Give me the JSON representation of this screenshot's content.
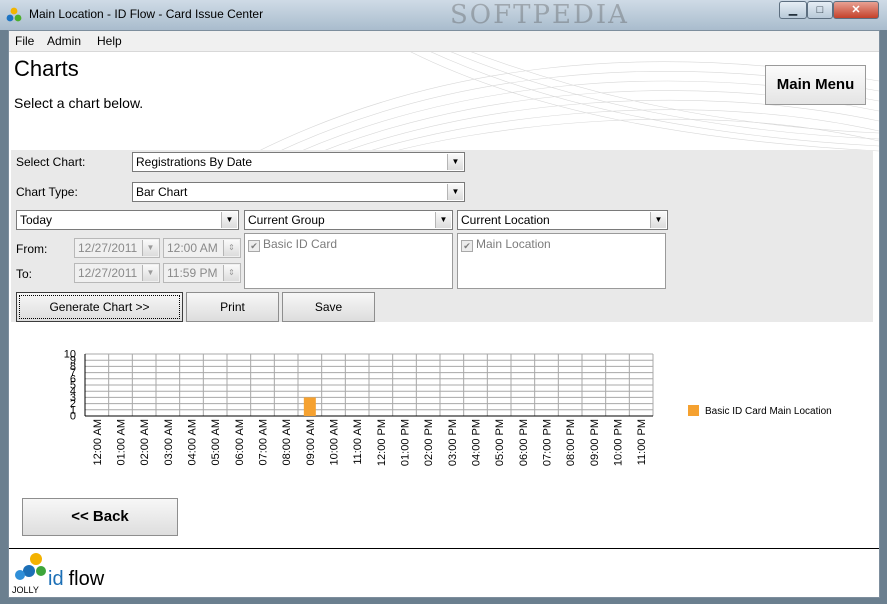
{
  "window": {
    "title": "Main Location - ID Flow - Card Issue Center",
    "watermark": "SOFTPEDIA",
    "minimize_glyph": "▁",
    "maximize_glyph": "□",
    "close_glyph": "✕"
  },
  "menu": [
    "File",
    "Admin",
    "Help"
  ],
  "header": {
    "title": "Charts",
    "subtitle": "Select a chart below.",
    "main_menu_label": "Main Menu"
  },
  "form": {
    "select_chart_label": "Select Chart:",
    "select_chart_value": "Registrations By Date",
    "chart_type_label": "Chart Type:",
    "chart_type_value": "Bar Chart",
    "period_value": "Today",
    "group_value": "Current Group",
    "location_value": "Current Location",
    "from_label": "From:",
    "to_label": "To:",
    "from_date": "12/27/2011",
    "from_time": "12:00 AM",
    "to_date": "12/27/2011",
    "to_time": "11:59 PM",
    "group_items": [
      "Basic ID Card"
    ],
    "location_items": [
      "Main Location"
    ]
  },
  "buttons": {
    "generate": "Generate Chart >>",
    "print": "Print",
    "save": "Save",
    "back": "<< Back"
  },
  "chart_data": {
    "type": "bar",
    "categories": [
      "12:00 AM",
      "01:00 AM",
      "02:00 AM",
      "03:00 AM",
      "04:00 AM",
      "05:00 AM",
      "06:00 AM",
      "07:00 AM",
      "08:00 AM",
      "09:00 AM",
      "10:00 AM",
      "11:00 AM",
      "12:00 PM",
      "01:00 PM",
      "02:00 PM",
      "03:00 PM",
      "04:00 PM",
      "05:00 PM",
      "06:00 PM",
      "07:00 PM",
      "08:00 PM",
      "09:00 PM",
      "10:00 PM",
      "11:00 PM"
    ],
    "series": [
      {
        "name": "Basic ID Card Main Location",
        "values": [
          0,
          0,
          0,
          0,
          0,
          0,
          0,
          0,
          0,
          3,
          0,
          0,
          0,
          0,
          0,
          0,
          0,
          0,
          0,
          0,
          0,
          0,
          0,
          0
        ],
        "color": "#f5a130"
      }
    ],
    "yticks": [
      0,
      1,
      2,
      3,
      4,
      5,
      6,
      7,
      8,
      9,
      10
    ],
    "ylim": [
      0,
      10
    ],
    "grid": true,
    "legend": "right"
  },
  "footer": {
    "logo_caption": "JOLLY",
    "brand_id": "id",
    "brand_flow": "flow"
  }
}
